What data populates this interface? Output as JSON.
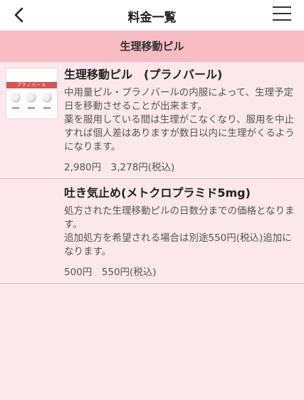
{
  "header": {
    "title": "料金一覧",
    "back_icon": "chevron-left-icon",
    "menu_icon": "hamburger-menu-icon"
  },
  "section": {
    "title": "生理移動ピル"
  },
  "items": [
    {
      "title": "生理移動ピル　(プラノバール)",
      "image_label": "プラノバール",
      "desc_lines": [
        "中用量ピル・プラノバールの内服によって、生理予定日を移動させることが出来ます。",
        "薬を服用している間は生理がこなくなり、服用を中止すれば個人差はありますが数日以内に生理がくるようになります。"
      ],
      "price": "2,980円　3,278円(税込)"
    },
    {
      "title": "吐き気止め(メトクロプラミド5mg)",
      "desc_lines": [
        "処方された生理移動ピルの日数分までの価格となります。",
        "追加処方を希望される場合は別途550円(税込)追加になります。"
      ],
      "price": "500円　550円(税込)"
    }
  ],
  "colors": {
    "background": "#fce8ea",
    "section_band": "#f7bcc3",
    "header_bg": "#ffffff"
  }
}
